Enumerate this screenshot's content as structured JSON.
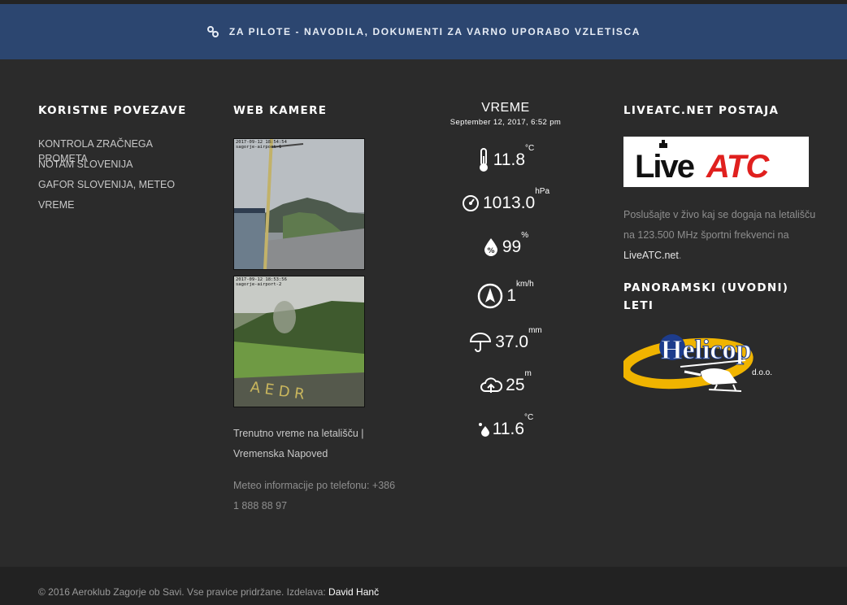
{
  "banner": {
    "text": "ZA PILOTE - NAVODILA, DOKUMENTI ZA VARNO UPORABO VZLETISCA",
    "icon": "link-icon"
  },
  "links_section": {
    "heading": "KORISTNE POVEZAVE",
    "items": [
      "KONTROLA ZRAČNEGA PROMETA",
      "NOTAM SLOVENIJA",
      "GAFOR SLOVENIJA, METEO",
      "VREME"
    ]
  },
  "cams": {
    "heading": "WEB KAMERE",
    "cam1_timestamp": "2017-09-12 18:54:54",
    "cam1_label": "sagorje-airport-1",
    "cam2_timestamp": "2017-09-12 18:53:56",
    "cam2_label": "sagorje-airport-2",
    "caption_line1": "Trenutno vreme na letališču |",
    "caption_line2": "Vremenska Napoved",
    "phone_line1": "Meteo informacije po telefonu: +386",
    "phone_line2": "1 888 88 97"
  },
  "weather": {
    "title": "VREME",
    "date": "September 12, 2017, 6:52 pm",
    "temp": {
      "value": "11.8",
      "unit": "°C"
    },
    "pressure": {
      "value": "1013.0",
      "unit": "hPa"
    },
    "humidity": {
      "value": "99",
      "unit": "%"
    },
    "wind": {
      "value": "1",
      "unit": "km/h"
    },
    "rain": {
      "value": "37.0",
      "unit": "mm"
    },
    "cloud": {
      "value": "25",
      "unit": "m"
    },
    "dewpoint": {
      "value": "11.6",
      "unit": "°C"
    }
  },
  "liveatc": {
    "heading": "LIVEATC.NET POSTAJA",
    "logo_text_live": "Live",
    "logo_text_atc": "ATC",
    "paragraph_pre": "Poslušajte v živo kaj se dogaja na letališču na 123.500 MHz športni frekvenci na ",
    "paragraph_link": "LiveATC.net",
    "paragraph_post": ".",
    "panoramic_heading_1": "PANORAMSKI (UVODNI)",
    "panoramic_heading_2": "LETI",
    "helicop_text": "Helicop",
    "helicop_sub": "d.o.o."
  },
  "footer": {
    "text": "© 2016 Aeroklub Zagorje ob Savi. Vse pravice pridržane. Izdelava: ",
    "author": "David Hanč"
  },
  "colors": {
    "banner": "#2c4670",
    "bg": "#2b2b2b",
    "footer": "#222222",
    "atc_red": "#e0201e",
    "helicop_yellow": "#f0b400"
  }
}
